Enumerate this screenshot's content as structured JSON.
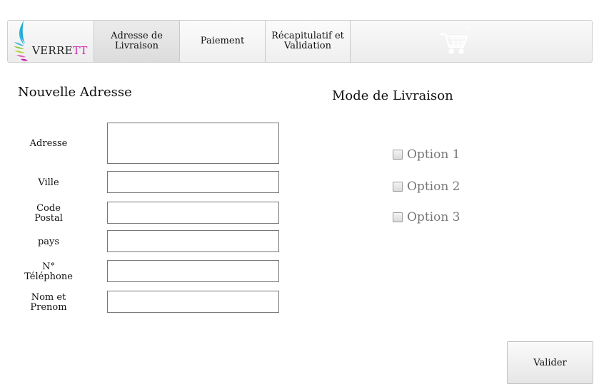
{
  "brand": {
    "name_main": "VERRE",
    "name_accent": "TT"
  },
  "nav": {
    "tabs": [
      {
        "label_line1": "Adresse de",
        "label_line2": "Livraison",
        "active": true
      },
      {
        "label_line1": "Paiement",
        "label_line2": "",
        "active": false
      },
      {
        "label_line1": "Récapitulatif et",
        "label_line2": "Validation",
        "active": false
      }
    ],
    "cart_icon": "shopping-cart-icon"
  },
  "address_form": {
    "title": "Nouvelle Adresse",
    "fields": [
      {
        "label_line1": "Adresse",
        "label_line2": "",
        "value": ""
      },
      {
        "label_line1": "Ville",
        "label_line2": "",
        "value": ""
      },
      {
        "label_line1": "Code",
        "label_line2": "Postal",
        "value": ""
      },
      {
        "label_line1": "pays",
        "label_line2": "",
        "value": ""
      },
      {
        "label_line1": "N°",
        "label_line2": "Téléphone",
        "value": ""
      },
      {
        "label_line1": "Nom et",
        "label_line2": "Prenom",
        "value": ""
      }
    ]
  },
  "delivery": {
    "title": "Mode de Livraison",
    "options": [
      {
        "label": "Option 1",
        "checked": false
      },
      {
        "label": "Option 2",
        "checked": false
      },
      {
        "label": "Option 3",
        "checked": false
      }
    ]
  },
  "submit": {
    "label": "Valider"
  },
  "colors": {
    "accent_magenta": "#d020b8",
    "logo_cyan": "#1aa8d8",
    "logo_green": "#8cc63f"
  }
}
